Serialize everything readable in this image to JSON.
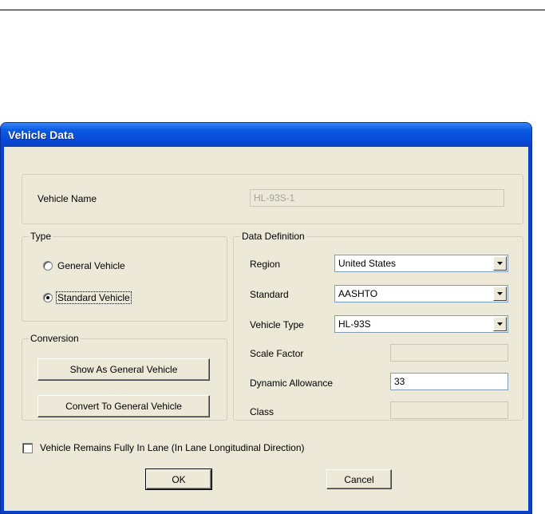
{
  "dialog": {
    "title": "Vehicle Data"
  },
  "vehicle_name": {
    "label": "Vehicle Name",
    "value": "HL-93S-1"
  },
  "type_group": {
    "title": "Type",
    "options": [
      {
        "label": "General Vehicle",
        "selected": false
      },
      {
        "label": "Standard Vehicle",
        "selected": true
      }
    ]
  },
  "conversion_group": {
    "title": "Conversion",
    "show_label": "Show As General Vehicle",
    "convert_label": "Convert To General Vehicle"
  },
  "data_definition": {
    "title": "Data Definition",
    "region": {
      "label": "Region",
      "value": "United States"
    },
    "standard": {
      "label": "Standard",
      "value": "AASHTO"
    },
    "vehicle_type": {
      "label": "Vehicle Type",
      "value": "HL-93S"
    },
    "scale_factor": {
      "label": "Scale Factor",
      "value": ""
    },
    "dynamic_allowance": {
      "label": "Dynamic Allowance",
      "value": "33"
    },
    "class": {
      "label": "Class",
      "value": ""
    }
  },
  "lane_checkbox": {
    "label": "Vehicle Remains Fully In Lane (In Lane Longitudinal Direction)",
    "checked": false
  },
  "buttons": {
    "ok": "OK",
    "cancel": "Cancel"
  }
}
